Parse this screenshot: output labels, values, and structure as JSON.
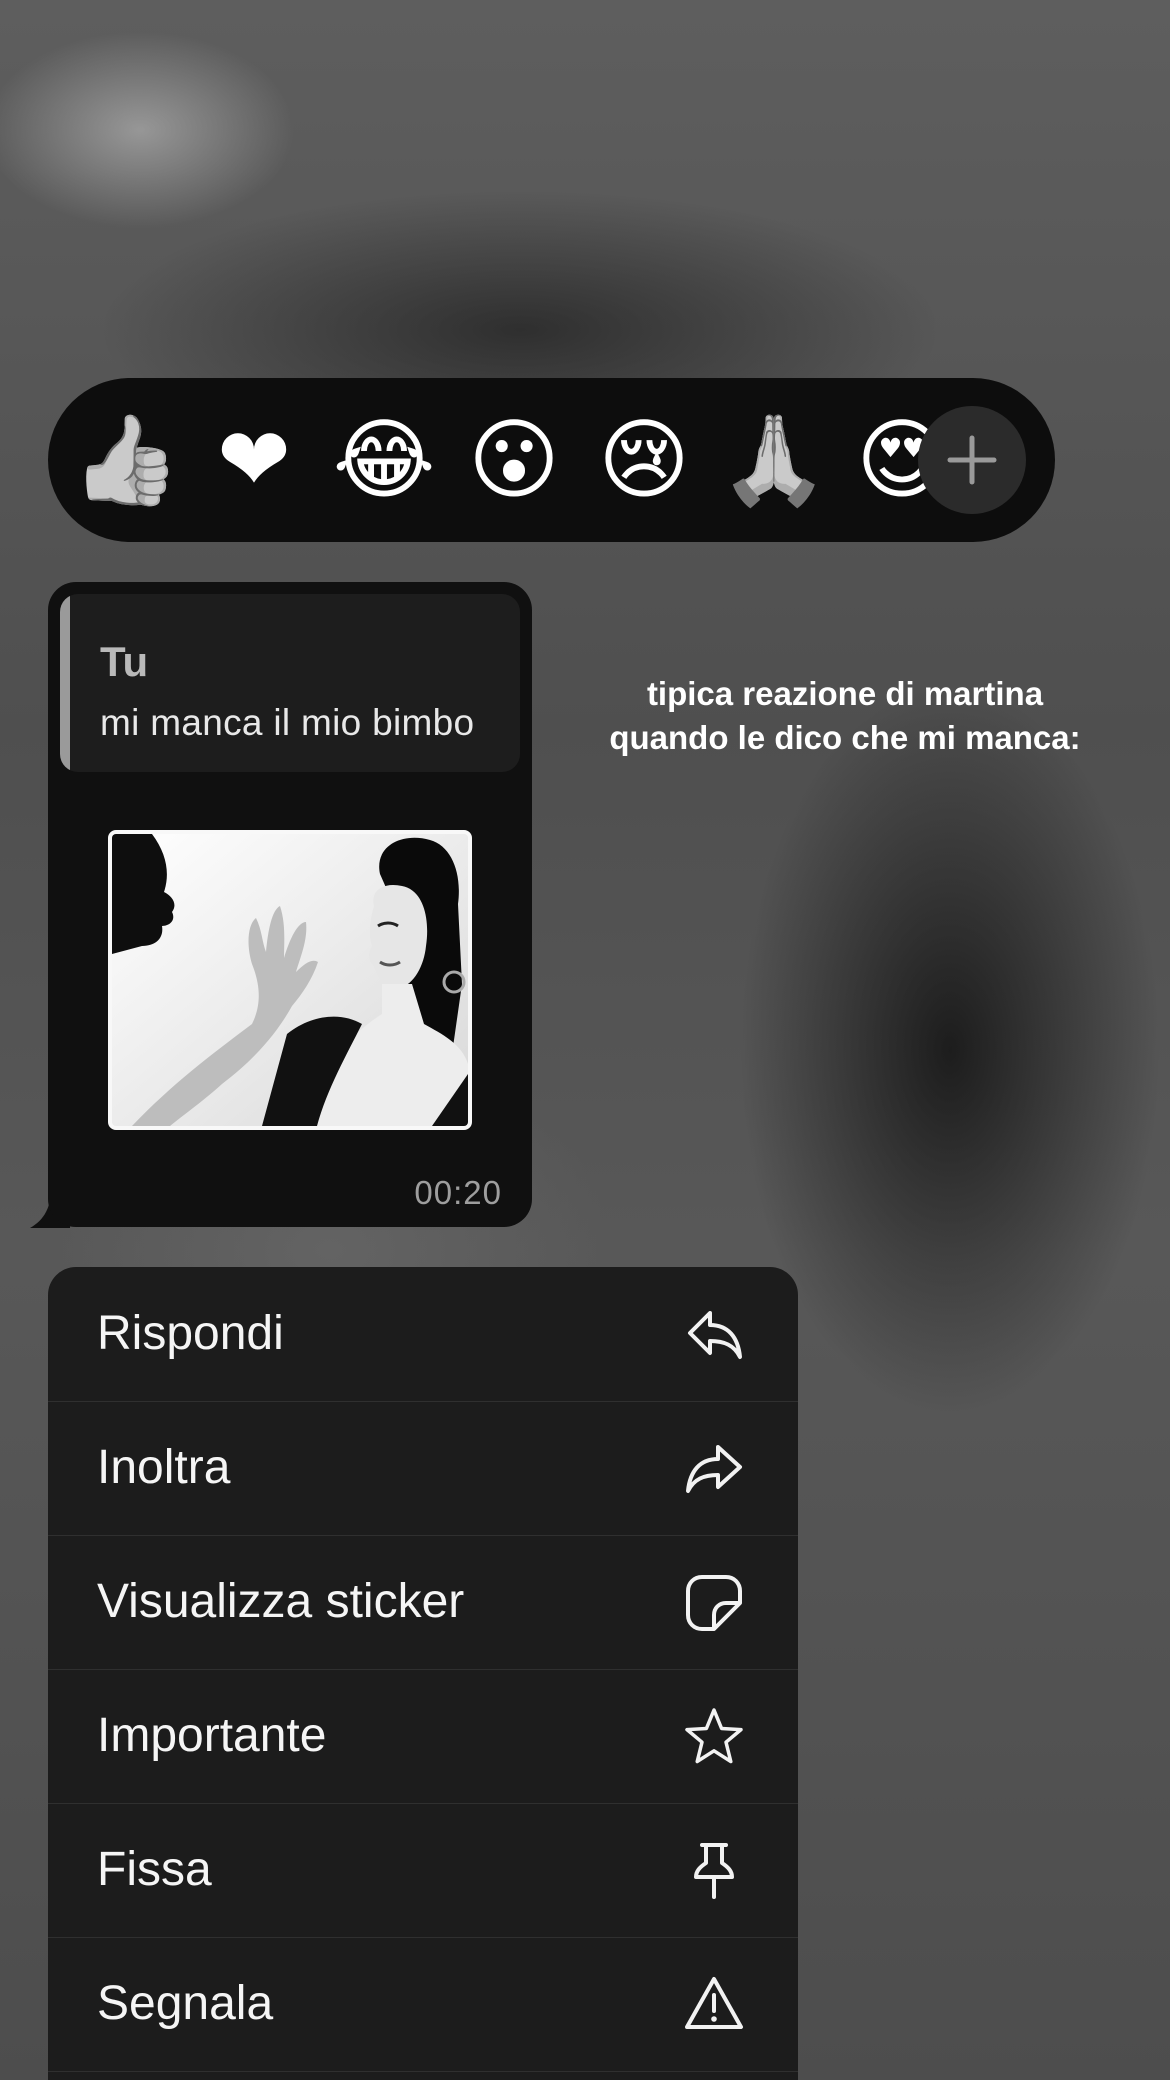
{
  "reactions": {
    "emojis": [
      {
        "name": "thumbs-up-icon",
        "glyph": "👍"
      },
      {
        "name": "heart-icon",
        "glyph": "❤"
      },
      {
        "name": "tears-of-joy-icon",
        "glyph": "😂"
      },
      {
        "name": "surprised-face-icon",
        "glyph": "😮"
      },
      {
        "name": "crying-face-icon",
        "glyph": "😢"
      },
      {
        "name": "folded-hands-icon",
        "glyph": "🙏"
      },
      {
        "name": "heart-eyes-icon",
        "glyph": "😍"
      }
    ],
    "more_icon": "plus-icon"
  },
  "message": {
    "quote_author": "Tu",
    "quote_text": "mi manca il mio bimbo",
    "time": "00:20"
  },
  "caption": {
    "line1": "tipica reazione di martina",
    "line2": "quando le dico che mi manca:"
  },
  "menu": {
    "items": [
      {
        "label": "Rispondi",
        "icon": "reply-icon"
      },
      {
        "label": "Inoltra",
        "icon": "forward-icon"
      },
      {
        "label": "Visualizza sticker",
        "icon": "sticker-icon"
      },
      {
        "label": "Importante",
        "icon": "star-icon"
      },
      {
        "label": "Fissa",
        "icon": "pin-icon"
      },
      {
        "label": "Segnala",
        "icon": "warning-icon"
      }
    ]
  }
}
